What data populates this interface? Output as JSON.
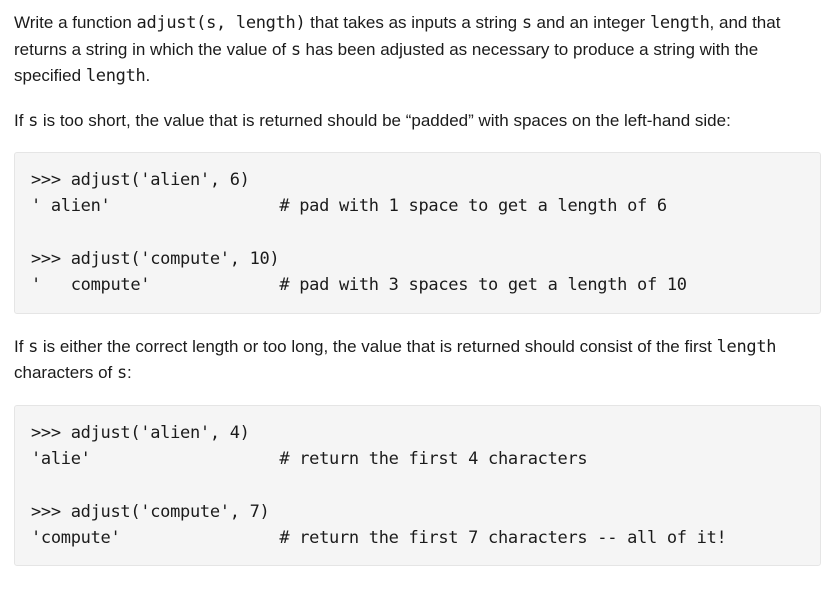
{
  "para1_pre": "Write a function ",
  "para1_code": "adjust(s, length)",
  "para1_mid1": " that takes as inputs a string ",
  "para1_code_s": "s",
  "para1_mid2": " and an integer ",
  "para1_code_length": "length",
  "para1_mid3": ", and that returns a string in which the value of ",
  "para1_code_s2": "s",
  "para1_mid4": " has been adjusted as necessary to produce a string with the specified ",
  "para1_code_length2": "length",
  "para1_end": ".",
  "para2_pre": "If ",
  "para2_code_s": "s",
  "para2_mid": " is too short, the value that is returned should be “padded” with spaces on the left-hand side:",
  "codeblock1": ">>> adjust('alien', 6)\n' alien'                 # pad with 1 space to get a length of 6\n\n>>> adjust('compute', 10)\n'   compute'             # pad with 3 spaces to get a length of 10",
  "para3_pre": "If ",
  "para3_code_s": "s",
  "para3_mid1": " is either the correct length or too long, the value that is returned should consist of the first ",
  "para3_code_length": "length",
  "para3_mid2": " characters of ",
  "para3_code_s2": "s",
  "para3_end": ":",
  "codeblock2": ">>> adjust('alien', 4)\n'alie'                   # return the first 4 characters\n\n>>> adjust('compute', 7)\n'compute'                # return the first 7 characters -- all of it!"
}
